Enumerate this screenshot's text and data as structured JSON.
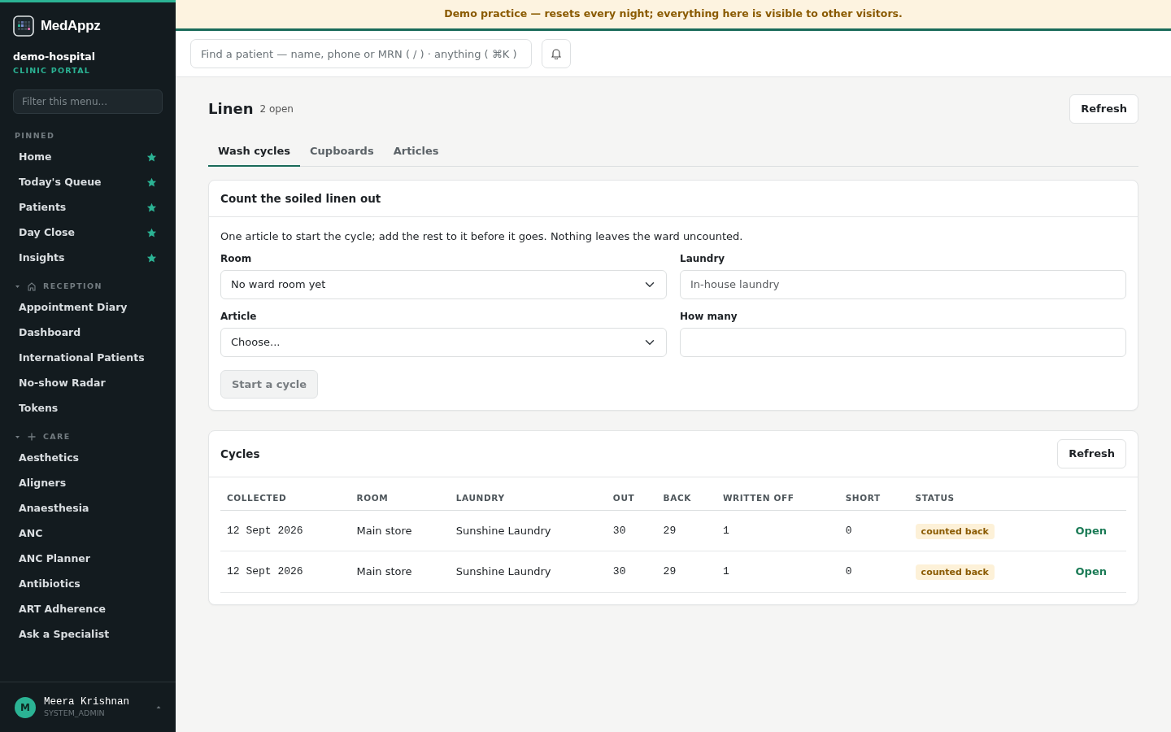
{
  "sidebar": {
    "brand": "MedAppz",
    "org": "demo-hospital",
    "portal": "CLINIC PORTAL",
    "filter": {
      "placeholder": "Filter this menu..."
    },
    "sections": [
      {
        "label": "PINNED",
        "kind": "pinned",
        "items": [
          {
            "label": "Home",
            "pinned": true
          },
          {
            "label": "Today's Queue",
            "pinned": true
          },
          {
            "label": "Patients",
            "pinned": true
          },
          {
            "label": "Day Close",
            "pinned": true
          },
          {
            "label": "Insights",
            "pinned": true
          }
        ]
      },
      {
        "label": "RECEPTION",
        "kind": "group",
        "expanded": true,
        "items": [
          {
            "label": "Appointment Diary",
            "pinned": false
          },
          {
            "label": "Dashboard",
            "pinned": false
          },
          {
            "label": "International Patients",
            "pinned": false
          },
          {
            "label": "No-show Radar",
            "pinned": false
          },
          {
            "label": "Tokens",
            "pinned": false
          }
        ]
      },
      {
        "label": "CARE",
        "kind": "group",
        "expanded": true,
        "items": [
          {
            "label": "Aesthetics",
            "pinned": false
          },
          {
            "label": "Aligners",
            "pinned": false
          },
          {
            "label": "Anaesthesia",
            "pinned": false
          },
          {
            "label": "ANC",
            "pinned": false
          },
          {
            "label": "ANC Planner",
            "pinned": false
          },
          {
            "label": "Antibiotics",
            "pinned": false
          },
          {
            "label": "ART Adherence",
            "pinned": false
          },
          {
            "label": "Ask a Specialist",
            "pinned": false
          }
        ]
      }
    ],
    "user": {
      "initial": "M",
      "name": "Meera Krishnan",
      "role": "SYSTEM_ADMIN"
    }
  },
  "banner": "Demo practice — resets every night; everything here is visible to other visitors.",
  "search": {
    "placeholder": "Find a patient — name, phone or MRN ( / ) · anything ( ⌘K )"
  },
  "page": {
    "title": "Linen",
    "count": "2 open",
    "refresh": "Refresh"
  },
  "tabs": [
    {
      "label": "Wash cycles",
      "selected": true
    },
    {
      "label": "Cupboards",
      "selected": false
    },
    {
      "label": "Articles",
      "selected": false
    }
  ],
  "form": {
    "title": "Count the soiled linen out",
    "intro": "One article to start the cycle; add the rest to it before it goes. Nothing leaves the ward uncounted.",
    "fields": [
      {
        "label": "Room",
        "kind": "select",
        "value": "No ward room yet"
      },
      {
        "label": "Laundry",
        "kind": "input",
        "placeholder": "In-house laundry"
      },
      {
        "label": "Article",
        "kind": "select",
        "value": "Choose..."
      },
      {
        "label": "How many",
        "kind": "input"
      }
    ],
    "submit": {
      "label": "Start a cycle",
      "disabled": true
    }
  },
  "cycles": {
    "title": "Cycles",
    "refresh": "Refresh",
    "columns": [
      "COLLECTED",
      "ROOM",
      "LAUNDRY",
      "OUT",
      "BACK",
      "WRITTEN OFF",
      "SHORT",
      "STATUS"
    ],
    "rows": [
      {
        "cells": [
          "12 Sept 2026",
          "Main store",
          "Sunshine Laundry",
          "30",
          "29",
          "1",
          "0"
        ],
        "status": "counted back",
        "action": "Open"
      },
      {
        "cells": [
          "12 Sept 2026",
          "Main store",
          "Sunshine Laundry",
          "30",
          "29",
          "1",
          "0"
        ],
        "status": "counted back",
        "action": "Open"
      }
    ]
  }
}
